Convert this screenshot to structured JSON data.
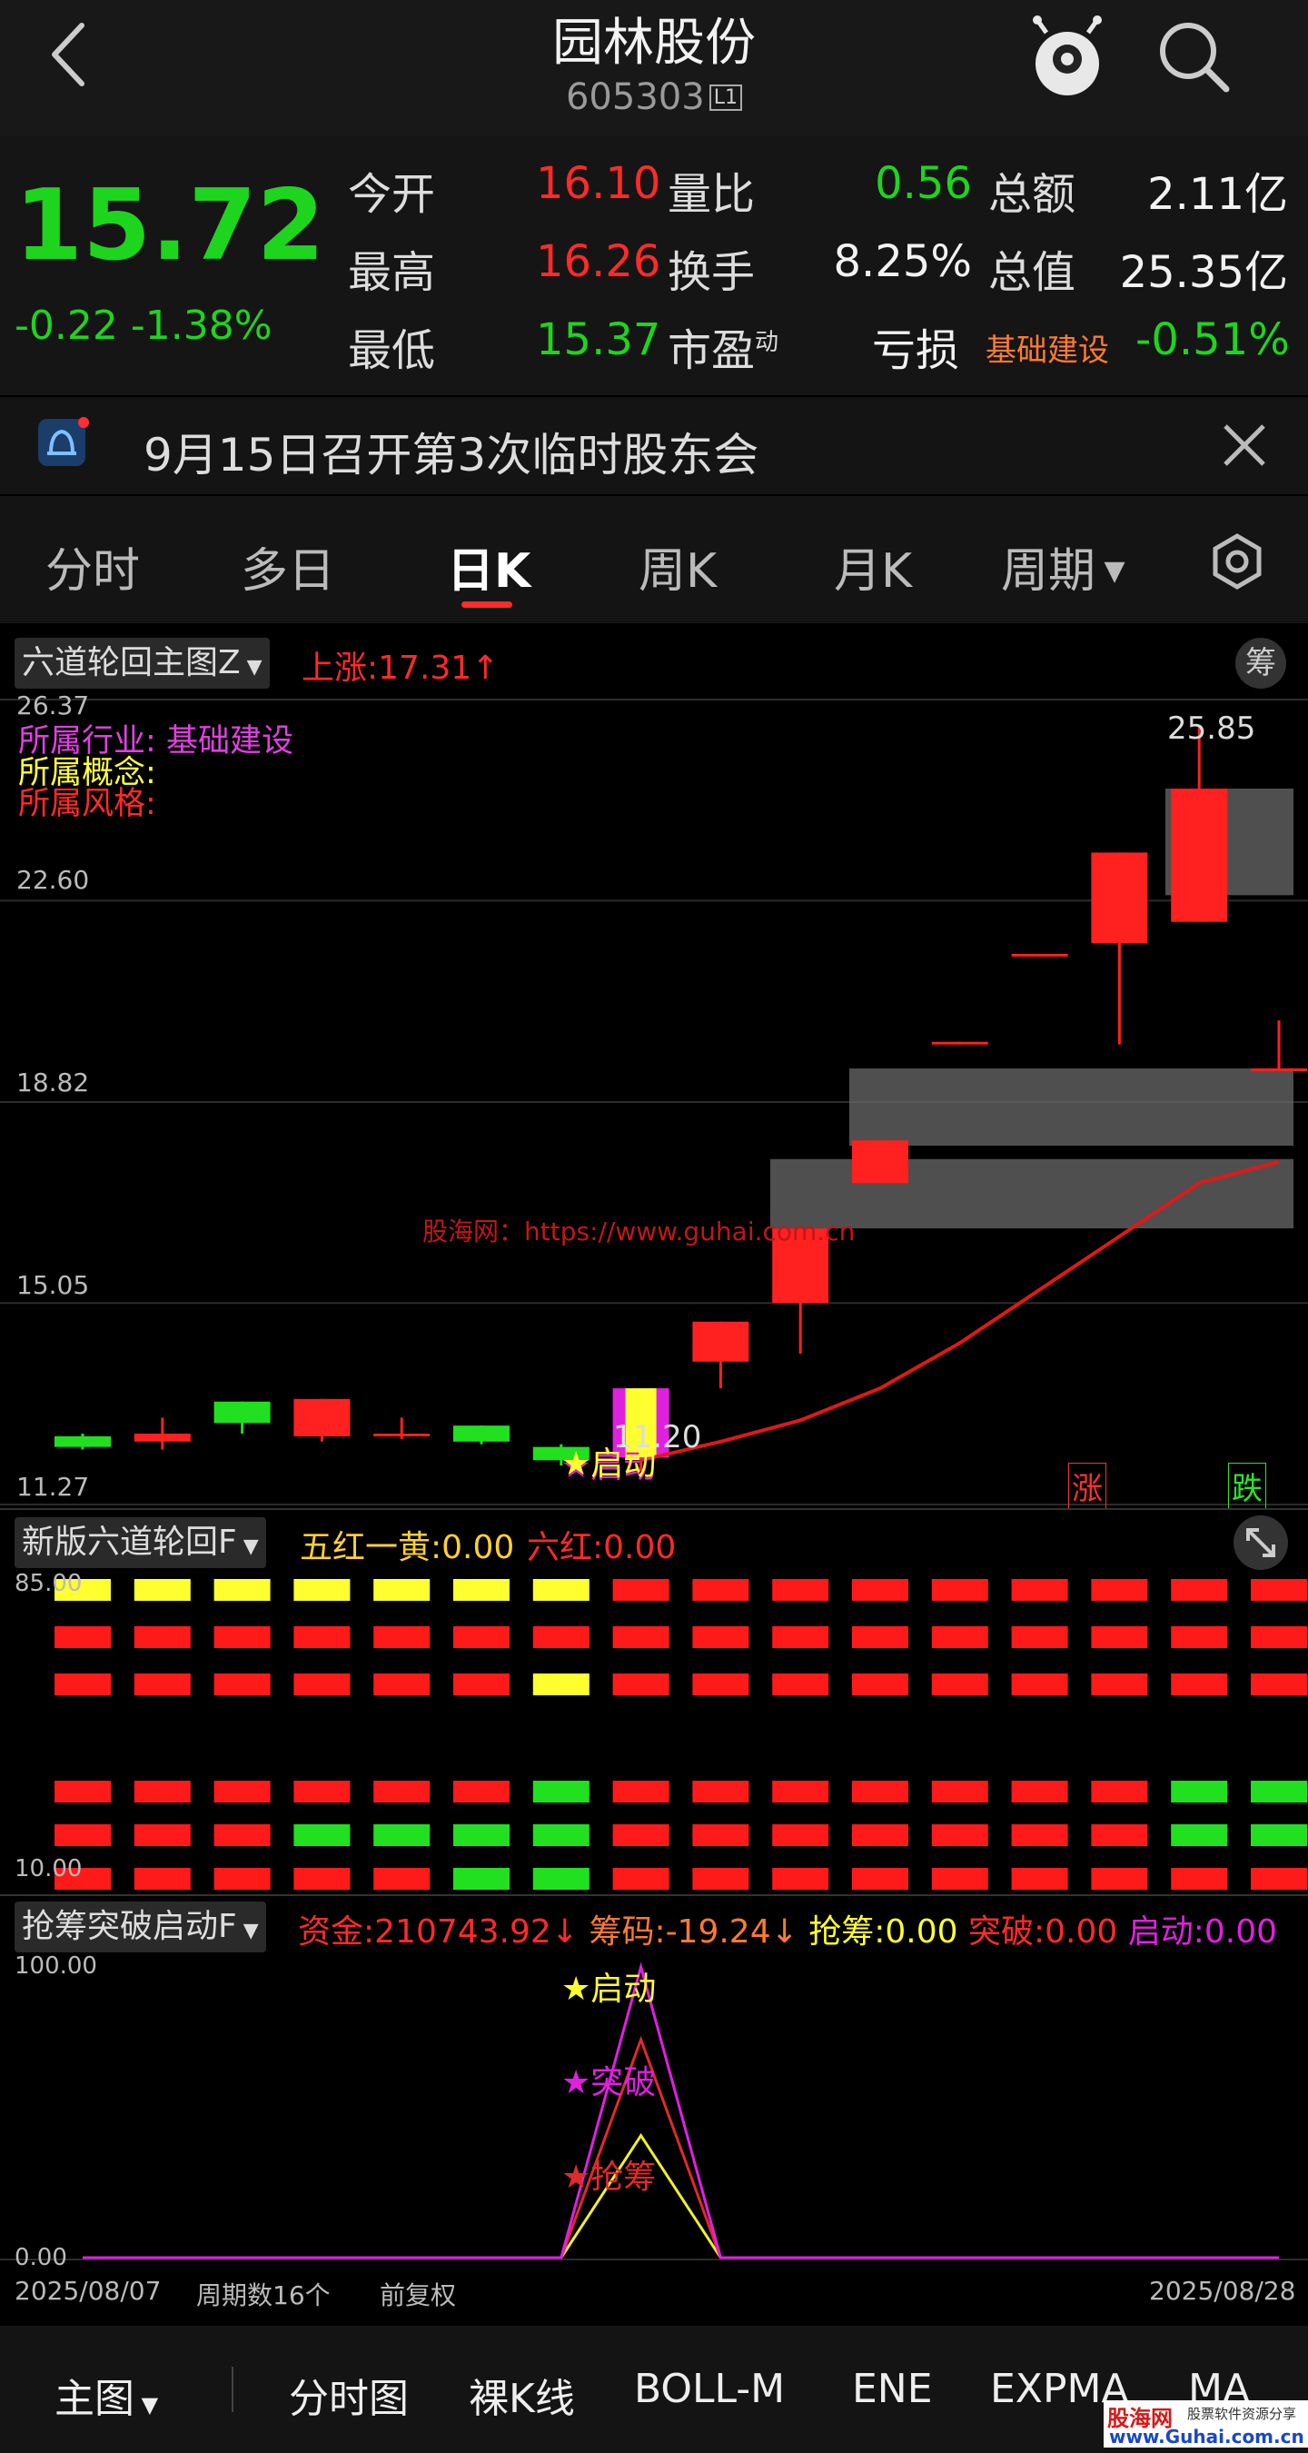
{
  "header": {
    "title": "园林股份",
    "code": "605303",
    "level_badge": "L1",
    "back_icon": "chevron-left-icon",
    "robot_icon": "robot-assistant-icon",
    "search_icon": "search-icon"
  },
  "quote": {
    "price": "15.72",
    "change": "-0.22",
    "change_pct": "-1.38%",
    "rows": [
      {
        "l1": "今开",
        "v1": "16.10",
        "l2": "量比",
        "v2": "0.56",
        "l3": "总额",
        "v3": "2.11亿"
      },
      {
        "l1": "最高",
        "v1": "16.26",
        "l2": "换手",
        "v2": "8.25%",
        "l3": "总值",
        "v3": "25.35亿"
      },
      {
        "l1": "最低",
        "v1": "15.37",
        "l2": "市盈",
        "v2": "亏损",
        "l3": "基础建设",
        "v3": "-0.51%"
      }
    ],
    "pe_sup": "动"
  },
  "notice": {
    "text": "9月15日召开第3次临时股东会"
  },
  "tabs": {
    "items": [
      "分时",
      "多日",
      "日K",
      "周K",
      "月K",
      "周期"
    ],
    "active_index": 2
  },
  "main_chart": {
    "indicator": "六道轮回主图Z",
    "rise_label": "上涨:17.31↑",
    "chips_badge": "筹",
    "industry_label": "所属行业:",
    "industry_value": "基础建设",
    "concept_label": "所属概念:",
    "style_label": "所属风格:",
    "y_ticks": [
      "26.37",
      "22.60",
      "18.82",
      "15.05",
      "11.27"
    ],
    "max_label": "25.85",
    "min_label": "11.20",
    "watermark": "股海网：https://www.guhai.com.cn",
    "start_marker": "★启动",
    "limit_up": "涨",
    "limit_down": "跌"
  },
  "chart_data": [
    {
      "type": "candlestick",
      "ylim": [
        11.27,
        26.37
      ],
      "candles": [
        {
          "open": 12.55,
          "close": 12.35,
          "high": 12.6,
          "low": 12.3
        },
        {
          "open": 12.45,
          "close": 12.6,
          "high": 12.9,
          "low": 12.3
        },
        {
          "open": 13.2,
          "close": 12.8,
          "high": 13.2,
          "low": 12.6
        },
        {
          "open": 12.55,
          "close": 13.25,
          "high": 13.25,
          "low": 12.45
        },
        {
          "open": 12.55,
          "close": 12.6,
          "high": 12.9,
          "low": 12.5
        },
        {
          "open": 12.75,
          "close": 12.45,
          "high": 12.75,
          "low": 12.4
        },
        {
          "open": 12.35,
          "close": 12.1,
          "high": 12.4,
          "low": 12.0
        },
        {
          "open": 12.15,
          "close": 13.45,
          "high": 13.45,
          "low": 11.9
        },
        {
          "open": 13.95,
          "close": 14.7,
          "high": 14.7,
          "low": 13.45
        },
        {
          "open": 15.05,
          "close": 16.45,
          "high": 16.45,
          "low": 14.1
        },
        {
          "open": 17.3,
          "close": 18.1,
          "high": 18.1,
          "low": 17.3
        },
        {
          "open": 19.9,
          "close": 19.95,
          "high": 19.95,
          "low": 19.9
        },
        {
          "open": 21.55,
          "close": 21.6,
          "high": 21.6,
          "low": 21.55
        },
        {
          "open": 21.8,
          "close": 23.5,
          "high": 23.5,
          "low": 19.9
        },
        {
          "open": 22.2,
          "close": 24.7,
          "high": 25.85,
          "low": 22.2
        },
        {
          "open": 19.45,
          "close": 19.45,
          "high": 20.35,
          "low": 19.4
        }
      ],
      "ma_line": [
        null,
        null,
        null,
        null,
        null,
        null,
        null,
        12.1,
        12.45,
        12.85,
        13.45,
        14.3,
        15.3,
        16.3,
        17.3,
        17.7
      ]
    },
    {
      "type": "heatmap",
      "title": "新版六道轮回F",
      "ylim": [
        10.0,
        85.0
      ],
      "columns": 16,
      "rows": [
        [
          "yellow",
          "yellow",
          "yellow",
          "yellow",
          "yellow",
          "yellow",
          "yellow",
          "red",
          "red",
          "red",
          "red",
          "red",
          "red",
          "red",
          "red",
          "red"
        ],
        [
          "red",
          "red",
          "red",
          "red",
          "red",
          "red",
          "red",
          "red",
          "red",
          "red",
          "red",
          "red",
          "red",
          "red",
          "red",
          "red"
        ],
        [
          "red",
          "red",
          "red",
          "red",
          "red",
          "red",
          "yellow",
          "red",
          "red",
          "red",
          "red",
          "red",
          "red",
          "red",
          "red",
          "red"
        ],
        [
          "red",
          "red",
          "red",
          "red",
          "red",
          "red",
          "green",
          "red",
          "red",
          "red",
          "red",
          "red",
          "red",
          "red",
          "green",
          "green"
        ],
        [
          "red",
          "red",
          "red",
          "green",
          "green",
          "green",
          "green",
          "red",
          "red",
          "red",
          "red",
          "red",
          "red",
          "red",
          "green",
          "green"
        ],
        [
          "red",
          "red",
          "red",
          "red",
          "red",
          "green",
          "green",
          "red",
          "red",
          "red",
          "red",
          "red",
          "red",
          "red",
          "red",
          "red"
        ]
      ]
    },
    {
      "type": "line",
      "ylim": [
        0.0,
        100.0
      ],
      "series": [
        {
          "name": "启动",
          "color": "#e020e0",
          "values": [
            0,
            0,
            0,
            0,
            0,
            0,
            0,
            100,
            0,
            0,
            0,
            0,
            0,
            0,
            0,
            0
          ]
        },
        {
          "name": "突破",
          "color": "#e02a2a",
          "values": [
            0,
            0,
            0,
            0,
            0,
            0,
            0,
            75,
            0,
            0,
            0,
            0,
            0,
            0,
            0,
            0
          ]
        },
        {
          "name": "抢筹",
          "color": "#f0f030",
          "values": [
            0,
            0,
            0,
            0,
            0,
            0,
            0,
            42,
            0,
            0,
            0,
            0,
            0,
            0,
            0,
            0
          ]
        }
      ]
    }
  ],
  "panel2": {
    "indicator": "新版六道轮回F",
    "legend": "五红一黄:0.00",
    "legend2": "六红:0.00",
    "y_top": "85.00",
    "y_bottom": "10.00",
    "expand_icon": "expand-icon"
  },
  "panel3": {
    "indicator": "抢筹突破启动F",
    "fund": "资金:210743.92↓",
    "chips": "筹码:-19.24↓",
    "grab": "抢筹:0.00",
    "break": "突破:0.00",
    "start": "启动:0.00",
    "y_top": "100.00",
    "y_bottom": "0.00",
    "markers": [
      "★启动",
      "★突破",
      "★抢筹"
    ]
  },
  "footer": {
    "date_start": "2025/08/07",
    "period_count": "周期数16个",
    "adjust": "前复权",
    "date_end": "2025/08/28"
  },
  "bottom": {
    "items": [
      "主图",
      "分时图",
      "裸K线",
      "BOLL-M",
      "ENE",
      "EXPMA",
      "MA"
    ],
    "logo": "股海网",
    "logo_sub": "股票软件资源分享",
    "logo_url": "www.Guhai.com.cn"
  },
  "colors": {
    "up": "#ff2020",
    "down": "#20e020",
    "yellow": "#ffff30",
    "magenta": "#e020e0"
  }
}
